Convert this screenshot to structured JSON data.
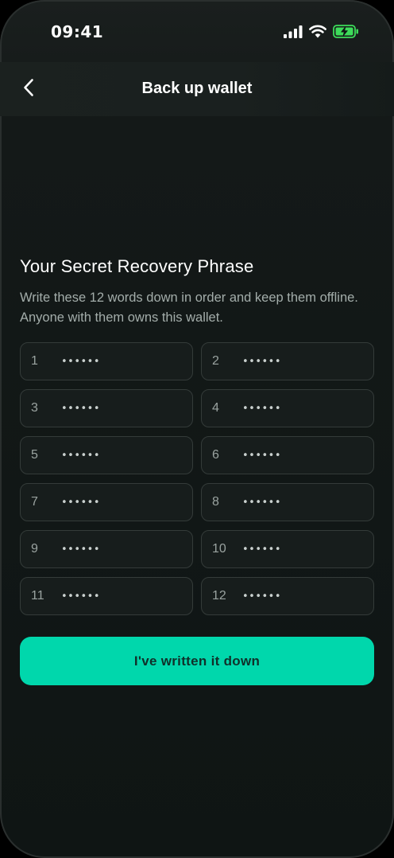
{
  "status_bar": {
    "time": "09:41",
    "icons": [
      "signal-icon",
      "wifi-icon",
      "battery-charging-icon"
    ]
  },
  "header": {
    "title": "Back up wallet",
    "back_icon": "chevron-left-icon"
  },
  "recovery": {
    "title": "Your Secret Recovery Phrase",
    "description": "Write these 12 words down in order and keep them offline. Anyone with them owns this wallet.",
    "words": [
      {
        "number": "1",
        "mask": "••••••"
      },
      {
        "number": "2",
        "mask": "••••••"
      },
      {
        "number": "3",
        "mask": "••••••"
      },
      {
        "number": "4",
        "mask": "••••••"
      },
      {
        "number": "5",
        "mask": "••••••"
      },
      {
        "number": "6",
        "mask": "••••••"
      },
      {
        "number": "7",
        "mask": "••••••"
      },
      {
        "number": "8",
        "mask": "••••••"
      },
      {
        "number": "9",
        "mask": "••••••"
      },
      {
        "number": "10",
        "mask": "••••••"
      },
      {
        "number": "11",
        "mask": "••••••"
      },
      {
        "number": "12",
        "mask": "••••••"
      }
    ]
  },
  "actions": {
    "confirm_label": "I've written it down"
  },
  "colors": {
    "accent": "#00d7ac",
    "battery": "#3ddc5a",
    "background": "#111716",
    "text_secondary": "#a3adaa"
  }
}
